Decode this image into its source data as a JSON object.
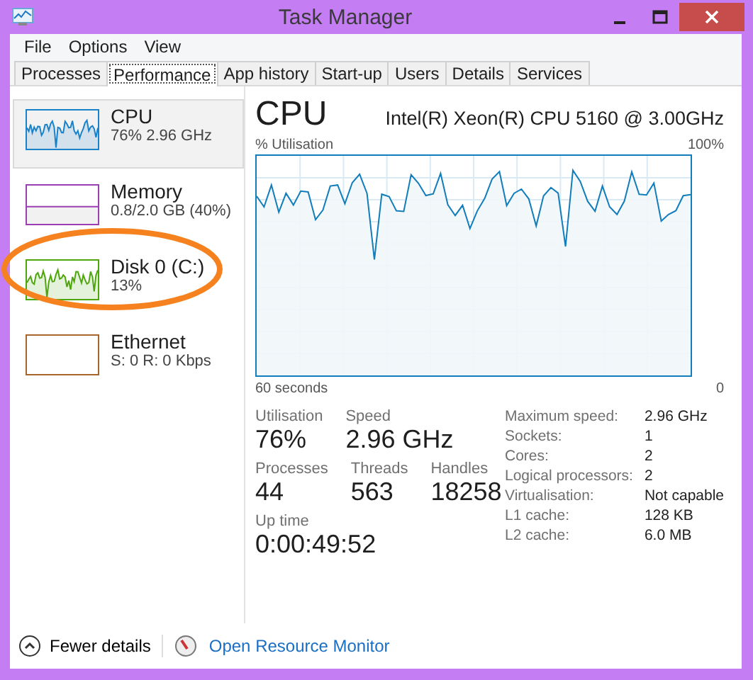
{
  "window": {
    "title": "Task Manager"
  },
  "menu": [
    "File",
    "Options",
    "View"
  ],
  "tabs": [
    {
      "label": "Processes",
      "selected": false
    },
    {
      "label": "Performance",
      "selected": true
    },
    {
      "label": "App history",
      "selected": false
    },
    {
      "label": "Start-up",
      "selected": false
    },
    {
      "label": "Users",
      "selected": false
    },
    {
      "label": "Details",
      "selected": false
    },
    {
      "label": "Services",
      "selected": false
    }
  ],
  "sidebar": {
    "items": [
      {
        "name": "CPU",
        "detail": "76%  2.96 GHz",
        "kind": "line",
        "color": "#1a82c8",
        "selected": true
      },
      {
        "name": "Memory",
        "detail": "0.8/2.0 GB (40%)",
        "kind": "bar",
        "color": "#9c3fb5",
        "selected": false
      },
      {
        "name": "Disk 0 (C:)",
        "detail": "13%",
        "kind": "line",
        "color": "#4da60c",
        "selected": false
      },
      {
        "name": "Ethernet",
        "detail": "S: 0 R: 0 Kbps",
        "kind": "empty",
        "color": "#a7652b",
        "selected": false
      }
    ]
  },
  "main": {
    "title": "CPU",
    "model": "Intel(R) Xeon(R) CPU 5160 @ 3.00GHz",
    "graph_label": "% Utilisation",
    "graph_max": "100%",
    "graph_span": "60 seconds",
    "graph_min": "0",
    "stats": [
      [
        {
          "label": "Utilisation",
          "value": "76%"
        },
        {
          "label": "Speed",
          "value": "2.96 GHz"
        }
      ],
      [
        {
          "label": "Processes",
          "value": "44"
        },
        {
          "label": "Threads",
          "value": "563"
        },
        {
          "label": "Handles",
          "value": "18258"
        }
      ],
      [
        {
          "label": "Up time",
          "value": "0:00:49:52"
        }
      ]
    ],
    "specs": [
      {
        "label": "Maximum speed:",
        "value": "2.96 GHz"
      },
      {
        "label": "Sockets:",
        "value": "1"
      },
      {
        "label": "Cores:",
        "value": "2"
      },
      {
        "label": "Logical processors:",
        "value": "2"
      },
      {
        "label": "Virtualisation:",
        "value": "Not capable"
      },
      {
        "label": "L1 cache:",
        "value": "128 KB"
      },
      {
        "label": "L2 cache:",
        "value": "6.0 MB"
      }
    ]
  },
  "footer": {
    "fewer": "Fewer details",
    "link": "Open Resource Monitor"
  }
}
